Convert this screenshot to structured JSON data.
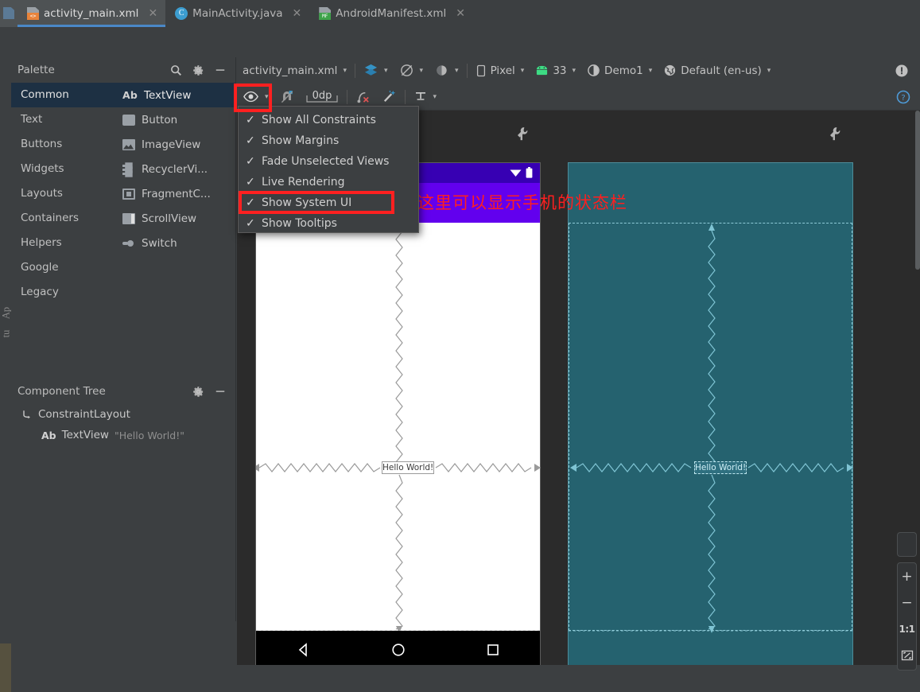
{
  "tabs": [
    {
      "label": "activity_main.xml",
      "icon": "xml-file-icon",
      "active": true
    },
    {
      "label": "MainActivity.java",
      "icon": "java-class-icon",
      "active": false
    },
    {
      "label": "AndroidManifest.xml",
      "icon": "manifest-file-icon",
      "active": false
    }
  ],
  "close_glyph": "✕",
  "left_rail": {
    "app_inspection": "Ap",
    "structure": "tu"
  },
  "palette": {
    "title": "Palette",
    "search_icon": "search-icon",
    "gear_icon": "gear-icon",
    "minimize_icon": "minimize-icon",
    "categories": [
      {
        "label": "Common",
        "selected": true
      },
      {
        "label": "Text",
        "selected": false
      },
      {
        "label": "Buttons",
        "selected": false
      },
      {
        "label": "Widgets",
        "selected": false
      },
      {
        "label": "Layouts",
        "selected": false
      },
      {
        "label": "Containers",
        "selected": false
      },
      {
        "label": "Helpers",
        "selected": false
      },
      {
        "label": "Google",
        "selected": false
      },
      {
        "label": "Legacy",
        "selected": false
      }
    ],
    "items": [
      {
        "label": "TextView",
        "prefix": "Ab",
        "icon": "textview-icon",
        "selected": true
      },
      {
        "label": "Button",
        "prefix": "",
        "icon": "button-icon",
        "selected": false
      },
      {
        "label": "ImageView",
        "prefix": "",
        "icon": "imageview-icon",
        "selected": false
      },
      {
        "label": "RecyclerVi...",
        "prefix": "",
        "icon": "recyclerview-icon",
        "selected": false
      },
      {
        "label": "FragmentC...",
        "prefix": "",
        "icon": "fragment-container-icon",
        "selected": false
      },
      {
        "label": "ScrollView",
        "prefix": "",
        "icon": "scrollview-icon",
        "selected": false
      },
      {
        "label": "Switch",
        "prefix": "",
        "icon": "switch-icon",
        "selected": false
      }
    ]
  },
  "component_tree": {
    "title": "Component Tree",
    "gear_icon": "gear-icon",
    "minimize_icon": "minimize-icon",
    "rows": [
      {
        "label": "ConstraintLayout",
        "prefix": "",
        "hint": "",
        "icon": "constraint-layout-icon"
      },
      {
        "label": "TextView",
        "prefix": "Ab",
        "hint": "\"Hello World!\"",
        "icon": "textview-icon"
      }
    ]
  },
  "toolbar": {
    "file_label": "activity_main.xml",
    "design_mode_icon": "layers-design-icon",
    "orientation_icon": "rotate-orientation-icon",
    "theme_icon": "theme-icon",
    "device_label": "Pixel",
    "device_icon": "phone-icon",
    "api_label": "33",
    "api_icon": "android-robot-icon",
    "theme_label": "Demo1",
    "theme_select_icon": "contrast-circle-icon",
    "locale_label": "Default (en-us)",
    "locale_icon": "globe-icon",
    "warning_icon": "warning-exclamation-icon",
    "help_icon": "help-question-icon"
  },
  "toolbar2": {
    "view_options_icon": "eye-icon",
    "autoconnect_icon": "autoconnect-magnet-icon",
    "margin_value": "0dp",
    "clear_constraints_icon": "clear-constraints-icon",
    "infer_constraints_icon": "infer-constraints-wand-icon",
    "align_icon": "align-baseline-icon"
  },
  "menu": {
    "items": [
      {
        "label": "Show All Constraints",
        "checked": true
      },
      {
        "label": "Show Margins",
        "checked": true
      },
      {
        "label": "Fade Unselected Views",
        "checked": true
      },
      {
        "label": "Live Rendering",
        "checked": true
      },
      {
        "label": "Show System UI",
        "checked": true,
        "highlighted": true
      },
      {
        "label": "Show Tooltips",
        "checked": true
      }
    ],
    "check_glyph": "✓"
  },
  "design_surface": {
    "annotation_text": "这里可以显示手机的状态栏",
    "annotation_color": "#ff1f1f",
    "design_preview": {
      "textview_label": "Hello World!",
      "statusbar_color": "#3700b3",
      "appbar_color": "#6200ee",
      "wifi_icon": "wifi-icon",
      "battery_icon": "battery-icon",
      "nav_back_icon": "nav-back-triangle-icon",
      "nav_home_icon": "nav-home-circle-icon",
      "nav_recents_icon": "nav-recents-square-icon",
      "wrench_icon": "render-options-wrench-icon"
    },
    "blueprint_preview": {
      "textview_label": "Hello World!",
      "surface_color": "#25626f",
      "wrench_icon": "render-options-wrench-icon"
    }
  },
  "zoom_rail": {
    "pan_icon": "pan-tool-icon",
    "zoom_in": "+",
    "zoom_out": "−",
    "actual_size": "1:1",
    "zoom_to_fit_icon": "zoom-to-fit-icon"
  }
}
